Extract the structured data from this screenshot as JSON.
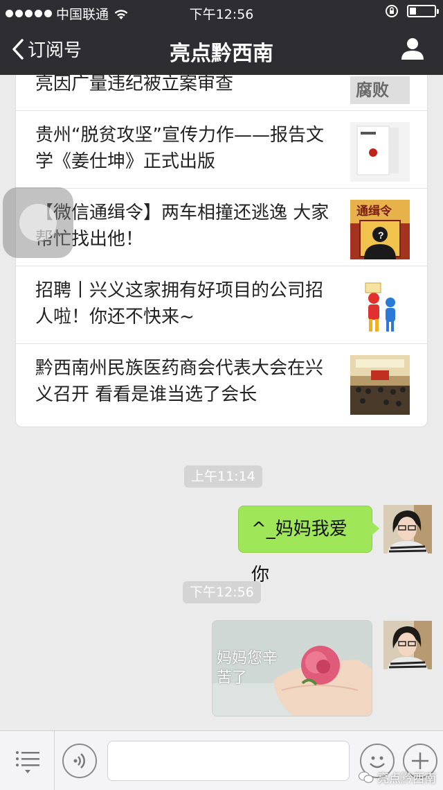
{
  "status_bar": {
    "carrier": "中国联通",
    "time": "下午12:56",
    "signal_bars": 5
  },
  "nav": {
    "back_label": "订阅号",
    "title": "亮点黔西南"
  },
  "articles": [
    {
      "title": "亮因广量违纪被立案审查"
    },
    {
      "title": "贵州“脱贫攻坚”宣传力作——报告文学《姜仕坤》正式出版"
    },
    {
      "title": "【微信通缉令】两车相撞还逃逸 大家帮忙找出他！",
      "thumb_text": "通缉令"
    },
    {
      "title": "招聘丨兴义这家拥有好项目的公司招人啦！你还不快来~"
    },
    {
      "title": "黔西南州民族医药商会代表大会在兴义召开 看看是谁当选了会长"
    }
  ],
  "messages": [
    {
      "timestamp": "上午11:14",
      "text": "^_妈妈我爱你"
    },
    {
      "timestamp": "下午12:56",
      "image_caption": "妈妈您辛苦了"
    }
  ],
  "watermark": "亮点黔西南",
  "colors": {
    "bar": "#2e2e32",
    "bubble": "#9fe658",
    "background": "#ebebeb"
  }
}
